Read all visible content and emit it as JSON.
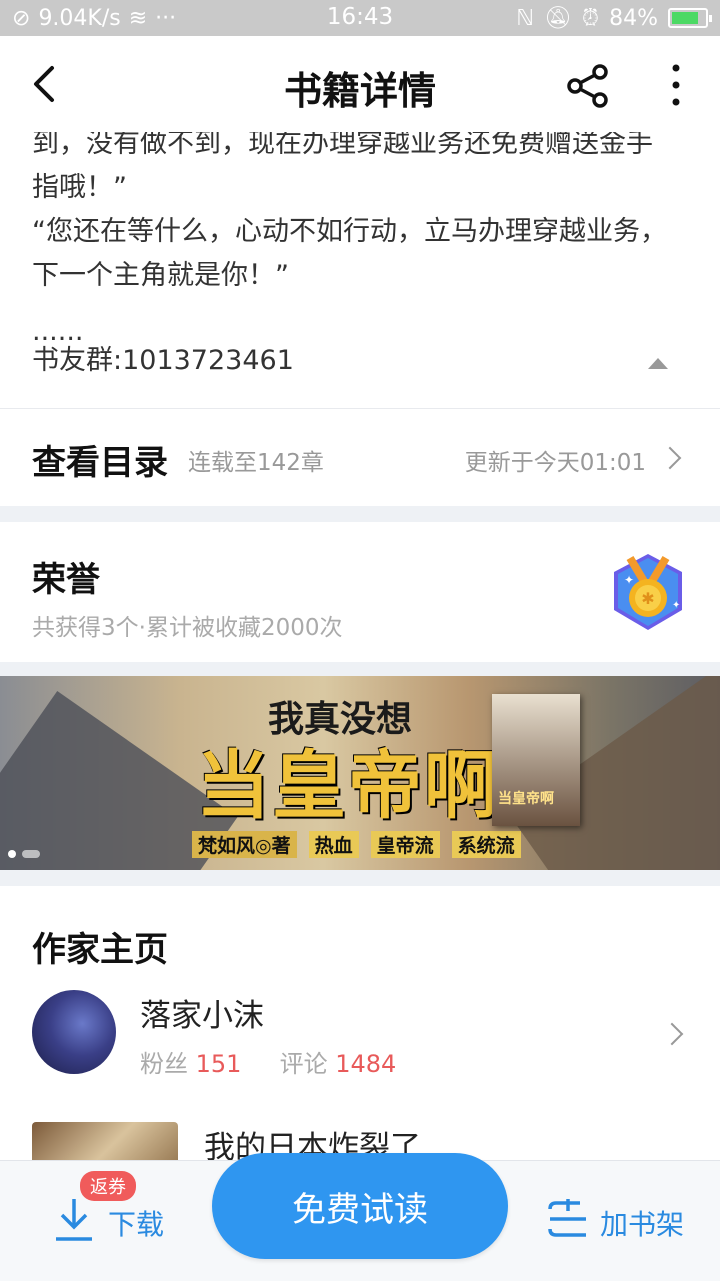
{
  "status_bar": {
    "net_speed": "9.04K/s",
    "time": "16:43",
    "battery": "84%",
    "battery_level": 0.84
  },
  "header": {
    "title": "书籍详情",
    "back_icon": "chevron-left-icon",
    "share_icon": "share-icon",
    "more_icon": "more-vertical-icon"
  },
  "synopsis": {
    "lines": [
      "到，没有做不到，现在办理穿越业务还免费赠送金手",
      "指哦！”",
      "“您还在等什么，心动不如行动，立马办理穿越业务，",
      "下一个主角就是你！”"
    ],
    "ellipsis": "......",
    "group": "书友群:1013723461"
  },
  "catalog": {
    "title": "查看目录",
    "progress": "连载至142章",
    "updated": "更新于今天01:01"
  },
  "honor": {
    "title": "荣誉",
    "summary": "共获得3个·累计被收藏2000次",
    "icon": "medal-icon"
  },
  "banner": {
    "subtitle": "我真没想",
    "main_title": "当皇帝啊",
    "author_tag": "梵如风◎著",
    "tags": [
      "热血",
      "皇帝流",
      "系统流"
    ],
    "cover_text": "当皇帝啊"
  },
  "author": {
    "section_title": "作家主页",
    "name": "落家小沫",
    "fans_label": "粉丝",
    "fans": "151",
    "comments_label": "评论",
    "comments": "1484",
    "book_title": "我的日本炸裂了"
  },
  "bottom_bar": {
    "coupon_badge": "返券",
    "download_label": "下载",
    "read_button": "免费试读",
    "shelf_label": "加书架"
  },
  "colors": {
    "accent": "#2f96f0",
    "badge": "#f05b5b",
    "stat_number": "#e85a5a"
  }
}
